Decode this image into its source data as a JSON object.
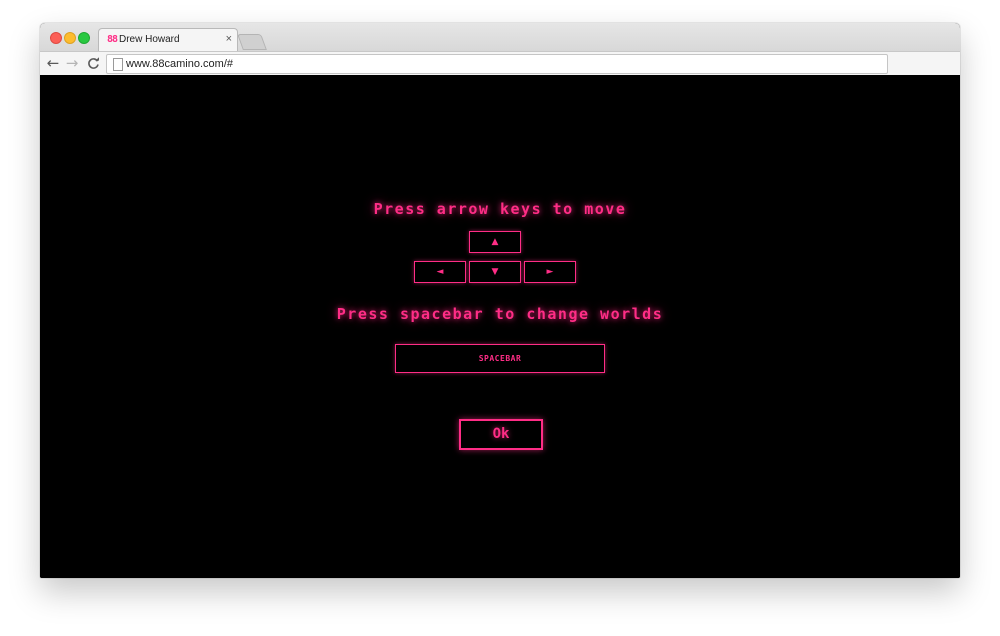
{
  "browser": {
    "tab": {
      "favicon": "88",
      "title": "Drew Howard",
      "close_glyph": "×"
    },
    "nav": {
      "back_glyph": "←",
      "forward_glyph": "→",
      "reload_glyph": "C"
    },
    "address": {
      "url": "www.88camino.com/#"
    }
  },
  "page": {
    "move_instruction": "Press arrow keys to move",
    "arrow_keys": {
      "up": "▲",
      "left": "◄",
      "down": "▼",
      "right": "►"
    },
    "world_instruction": "Press spacebar to change worlds",
    "spacebar_label": "SPACEBAR",
    "ok_label": "Ok"
  },
  "colors": {
    "accent": "#ff2d86",
    "background": "#000000"
  }
}
